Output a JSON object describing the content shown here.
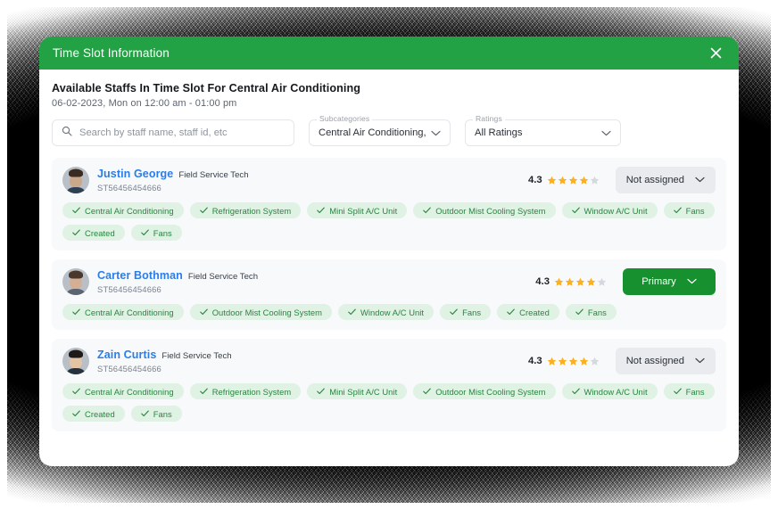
{
  "modal": {
    "title": "Time Slot Information",
    "close_icon": "close-icon",
    "heading": "Available Staffs In Time Slot For Central Air Conditioning",
    "subheading": "06-02-2023, Mon on 12:00 am - 01:00 pm"
  },
  "filters": {
    "search": {
      "icon": "search-icon",
      "placeholder": "Search by staff name, staff id, etc",
      "value": ""
    },
    "subcategories": {
      "label": "Subcategories",
      "value": "Central Air Conditioning, Re...",
      "icon": "chevron-down-icon"
    },
    "ratings": {
      "label": "Ratings",
      "value": "All Ratings",
      "icon": "chevron-down-icon"
    }
  },
  "colors": {
    "header_green": "#22A244",
    "primary_green": "#17912F",
    "chip_bg": "#DFF2E4",
    "chip_text": "#28853F",
    "name_blue": "#2B7DE9",
    "star_filled": "#FBB022",
    "star_empty": "#D5D9DE",
    "row_bg": "#F7F9FB",
    "assign_bg": "#E9EBEF"
  },
  "staff": [
    {
      "name": "Justin George",
      "role": "Field Service Tech",
      "code": "ST56456454666",
      "rating": "4.3",
      "stars_filled": 4,
      "stars_total": 5,
      "assignment": "Not assigned",
      "assignment_state": "unassigned",
      "skills": [
        "Central Air Conditioning",
        "Refrigeration System",
        "Mini Split A/C Unit",
        "Outdoor Mist Cooling System",
        "Window A/C Unit",
        "Fans",
        "Created",
        "Fans"
      ]
    },
    {
      "name": "Carter Bothman",
      "role": "Field Service Tech",
      "code": "ST56456454666",
      "rating": "4.3",
      "stars_filled": 4,
      "stars_total": 5,
      "assignment": "Primary",
      "assignment_state": "primary",
      "skills": [
        "Central Air Conditioning",
        "Outdoor Mist Cooling System",
        "Window A/C Unit",
        "Fans",
        "Created",
        "Fans"
      ]
    },
    {
      "name": "Zain Curtis",
      "role": "Field Service Tech",
      "code": "ST56456454666",
      "rating": "4.3",
      "stars_filled": 4,
      "stars_total": 5,
      "assignment": "Not assigned",
      "assignment_state": "unassigned",
      "skills": [
        "Central Air Conditioning",
        "Refrigeration System",
        "Mini Split A/C Unit",
        "Outdoor Mist Cooling System",
        "Window A/C Unit",
        "Fans",
        "Created",
        "Fans"
      ]
    }
  ]
}
